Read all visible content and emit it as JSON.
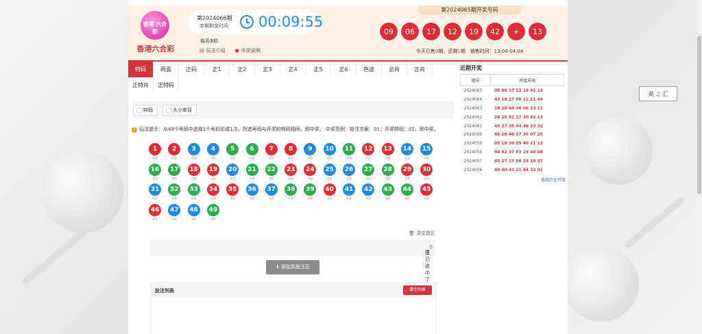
{
  "header": {
    "logo_text": "香港六合彩",
    "logo_badge": "香港 六合彩",
    "issue": "第2024066期",
    "remain_label": "本期剩余时间",
    "countdown": "00:09:55",
    "weekly_pre": "每周",
    "weekly_num": "3",
    "weekly_post": "期",
    "rules_link": "玩法介绍",
    "prize_link": "中奖说明",
    "last_draw_title": "第2024065期开奖号码",
    "last_draw": [
      "09",
      "06",
      "17",
      "12",
      "19",
      "42",
      "+",
      "13"
    ],
    "today_pre": "今天已售",
    "today_sold": "0",
    "today_mid": "期，还剩",
    "today_left": "1",
    "today_post": "期",
    "sale_time": "销售时间：13:04-04:04"
  },
  "tabs": [
    "特码",
    "两面",
    "正码",
    "正1",
    "正2",
    "正3",
    "正4",
    "正5",
    "正6",
    "色波",
    "总肖",
    "正肖",
    "正特肖",
    "正特码"
  ],
  "subtabs": [
    "特码",
    "大小单双"
  ],
  "tip": "玩法提示：从49个号码中选择1个号码形成1注，所选号码与开奖的特码相同，即中奖。 中奖范例：投注方案：01；开奖特码：01，即中奖。",
  "balls": [
    {
      "n": "1",
      "c": "red"
    },
    {
      "n": "2",
      "c": "red"
    },
    {
      "n": "3",
      "c": "blue"
    },
    {
      "n": "4",
      "c": "blue"
    },
    {
      "n": "5",
      "c": "green"
    },
    {
      "n": "6",
      "c": "green"
    },
    {
      "n": "7",
      "c": "red"
    },
    {
      "n": "8",
      "c": "red"
    },
    {
      "n": "9",
      "c": "blue"
    },
    {
      "n": "10",
      "c": "blue"
    },
    {
      "n": "11",
      "c": "green"
    },
    {
      "n": "12",
      "c": "red"
    },
    {
      "n": "13",
      "c": "red"
    },
    {
      "n": "14",
      "c": "blue"
    },
    {
      "n": "15",
      "c": "blue"
    },
    {
      "n": "16",
      "c": "green"
    },
    {
      "n": "17",
      "c": "green"
    },
    {
      "n": "18",
      "c": "red"
    },
    {
      "n": "19",
      "c": "red"
    },
    {
      "n": "20",
      "c": "blue"
    },
    {
      "n": "21",
      "c": "green"
    },
    {
      "n": "22",
      "c": "green"
    },
    {
      "n": "23",
      "c": "red"
    },
    {
      "n": "24",
      "c": "red"
    },
    {
      "n": "25",
      "c": "blue"
    },
    {
      "n": "26",
      "c": "blue"
    },
    {
      "n": "27",
      "c": "green"
    },
    {
      "n": "28",
      "c": "green"
    },
    {
      "n": "29",
      "c": "red"
    },
    {
      "n": "30",
      "c": "red"
    },
    {
      "n": "31",
      "c": "blue"
    },
    {
      "n": "32",
      "c": "green"
    },
    {
      "n": "33",
      "c": "green"
    },
    {
      "n": "34",
      "c": "red"
    },
    {
      "n": "35",
      "c": "red"
    },
    {
      "n": "36",
      "c": "blue"
    },
    {
      "n": "37",
      "c": "blue"
    },
    {
      "n": "38",
      "c": "green"
    },
    {
      "n": "39",
      "c": "green"
    },
    {
      "n": "40",
      "c": "red"
    },
    {
      "n": "41",
      "c": "blue"
    },
    {
      "n": "42",
      "c": "blue"
    },
    {
      "n": "43",
      "c": "green"
    },
    {
      "n": "44",
      "c": "green"
    },
    {
      "n": "45",
      "c": "red"
    },
    {
      "n": "46",
      "c": "red"
    },
    {
      "n": "47",
      "c": "blue"
    },
    {
      "n": "48",
      "c": "blue"
    },
    {
      "n": "49",
      "c": "green"
    }
  ],
  "odds": "48",
  "clear_selection": "清空选区",
  "selected_pre": "您已选中了",
  "selected_count": "0",
  "selected_post": "注",
  "add_button": "添加到投注区",
  "bet_list_title": "投注列表",
  "bet_clear": "清空列表",
  "side": {
    "title": "近期开奖",
    "col_issue": "期号",
    "col_nums": "开奖号码",
    "rows": [
      {
        "issue": "2024065",
        "nums": "09 06 17 12 19 42 13"
      },
      {
        "issue": "2024064",
        "nums": "43 19 27 06 11 21 44"
      },
      {
        "issue": "2024063",
        "nums": "18 28 48 36 06 33 11"
      },
      {
        "issue": "2024062",
        "nums": "24 25 01 27 30 32 13"
      },
      {
        "issue": "2024061",
        "nums": "43 37 38 44 46 33 32"
      },
      {
        "issue": "2024060",
        "nums": "49 26 46 37 30 07 25"
      },
      {
        "issue": "2024059",
        "nums": "05 18 36 09 40 21 13"
      },
      {
        "issue": "2024058",
        "nums": "04 02 37 03 15 40 08"
      },
      {
        "issue": "2024057",
        "nums": "45 27 17 08 33 19 37"
      },
      {
        "issue": "2024056",
        "nums": "49 40 43 21 44 32 01"
      }
    ],
    "history_link": "查阅历史开奖"
  },
  "float_badge": "英 ♫ 汇"
}
